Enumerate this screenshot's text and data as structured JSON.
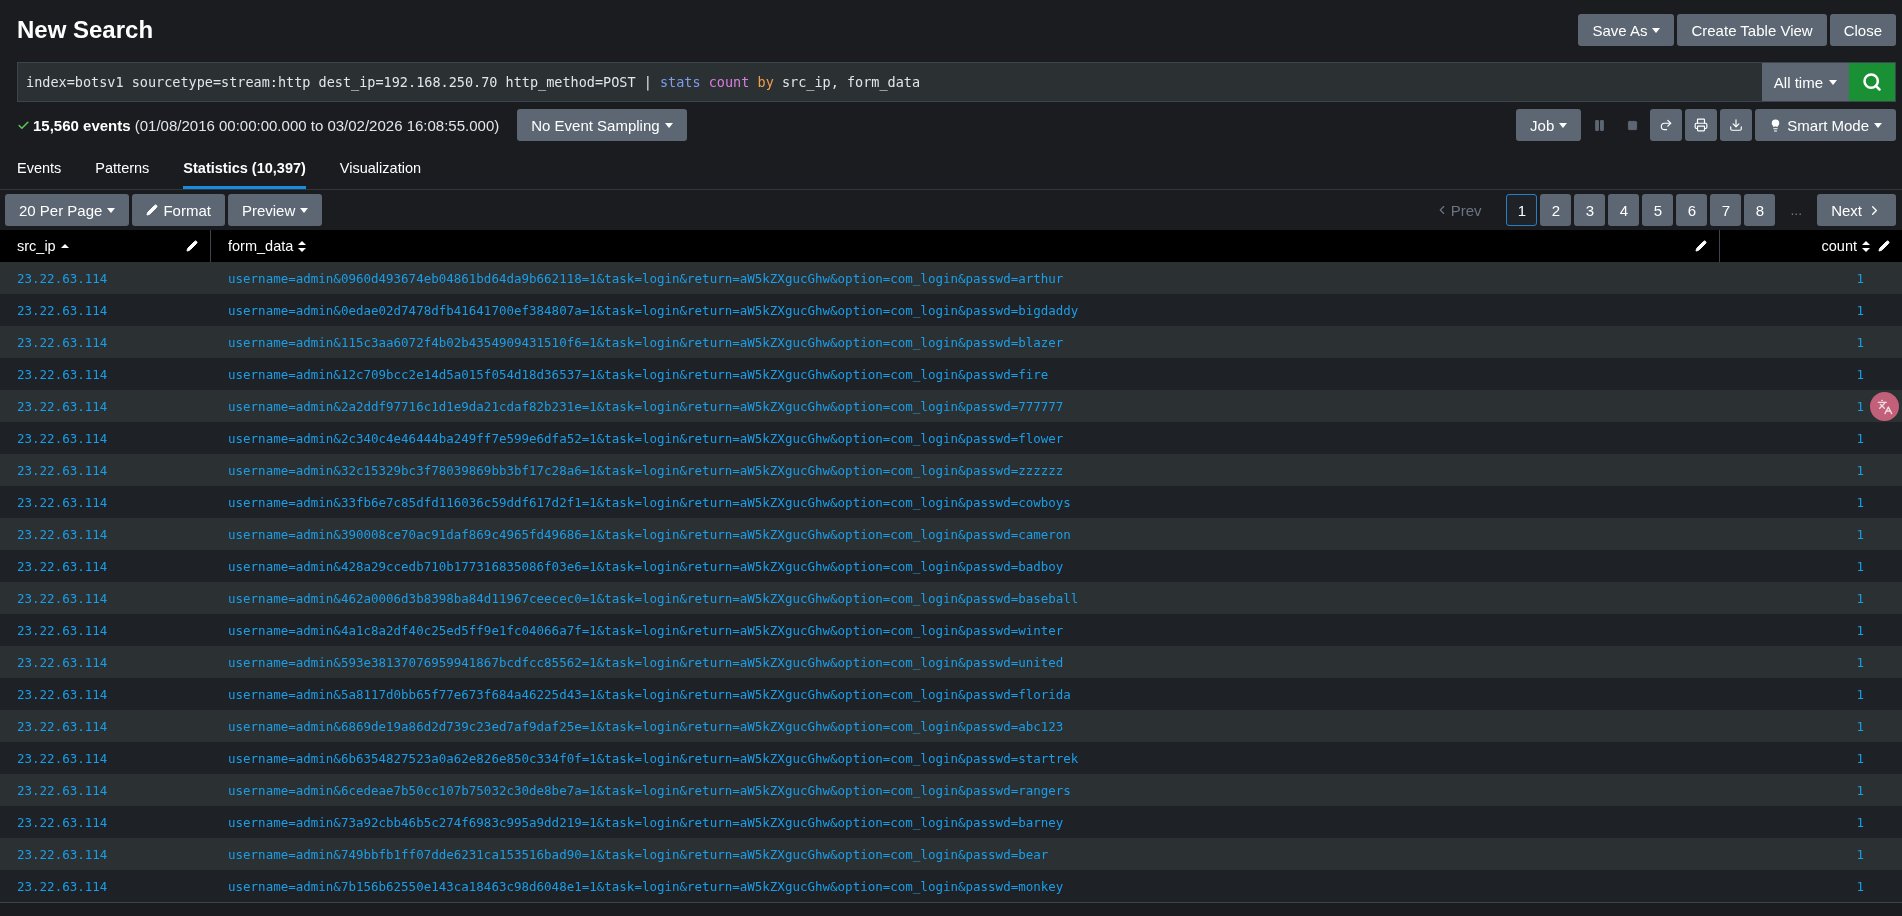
{
  "title": "New Search",
  "header_buttons": [
    {
      "label": "Save As",
      "dropdown": true
    },
    {
      "label": "Create Table View",
      "dropdown": false
    },
    {
      "label": "Close",
      "dropdown": false
    }
  ],
  "query": [
    {
      "kind": "plain",
      "text": "index=botsv1 sourcetype=stream:http dest_ip=192.168.250.70 http_method=POST | "
    },
    {
      "kind": "command",
      "text": "stats"
    },
    {
      "kind": "function",
      "text": " count"
    },
    {
      "kind": "keyword",
      "text": " by"
    },
    {
      "kind": "plain",
      "text": " src_ip, form_data"
    }
  ],
  "time_range": "All time",
  "status": {
    "count": "15,560 events",
    "range": "(01/08/2016 00:00:00.000 to 03/02/2026 16:08:55.000)",
    "sampling": "No Event Sampling"
  },
  "job": {
    "label": "Job",
    "mode": "Smart Mode"
  },
  "tabs": [
    {
      "label": "Events",
      "selected": false
    },
    {
      "label": "Patterns",
      "selected": false
    },
    {
      "label": "Statistics (10,397)",
      "selected": true
    },
    {
      "label": "Visualization",
      "selected": false
    }
  ],
  "toolbar": {
    "per_page": "20 Per Page",
    "format": "Format",
    "preview": "Preview"
  },
  "pagination": {
    "prev": "Prev",
    "next": "Next",
    "ellipsis": "...",
    "pages": [
      {
        "label": "1",
        "selected": true
      },
      {
        "label": "2",
        "selected": false
      },
      {
        "label": "3",
        "selected": false
      },
      {
        "label": "4",
        "selected": false
      },
      {
        "label": "5",
        "selected": false
      },
      {
        "label": "6",
        "selected": false
      },
      {
        "label": "7",
        "selected": false
      },
      {
        "label": "8",
        "selected": false
      }
    ]
  },
  "table": {
    "columns": [
      {
        "label": "src_ip",
        "sorted": true
      },
      {
        "label": "form_data",
        "sorted": false
      },
      {
        "label": "count",
        "sorted": false
      }
    ],
    "rows": [
      [
        "23.22.63.114",
        "username=admin&0960d493674eb04861bd64da9b662118=1&task=login&return=aW5kZXgucGhw&option=com_login&passwd=arthur",
        "1"
      ],
      [
        "23.22.63.114",
        "username=admin&0edae02d7478dfb41641700ef384807a=1&task=login&return=aW5kZXgucGhw&option=com_login&passwd=bigdaddy",
        "1"
      ],
      [
        "23.22.63.114",
        "username=admin&115c3aa6072f4b02b4354909431510f6=1&task=login&return=aW5kZXgucGhw&option=com_login&passwd=blazer",
        "1"
      ],
      [
        "23.22.63.114",
        "username=admin&12c709bcc2e14d5a015f054d18d36537=1&task=login&return=aW5kZXgucGhw&option=com_login&passwd=fire",
        "1"
      ],
      [
        "23.22.63.114",
        "username=admin&2a2ddf97716c1d1e9da21cdaf82b231e=1&task=login&return=aW5kZXgucGhw&option=com_login&passwd=777777",
        "1"
      ],
      [
        "23.22.63.114",
        "username=admin&2c340c4e46444ba249ff7e599e6dfa52=1&task=login&return=aW5kZXgucGhw&option=com_login&passwd=flower",
        "1"
      ],
      [
        "23.22.63.114",
        "username=admin&32c15329bc3f78039869bb3bf17c28a6=1&task=login&return=aW5kZXgucGhw&option=com_login&passwd=zzzzzz",
        "1"
      ],
      [
        "23.22.63.114",
        "username=admin&33fb6e7c85dfd116036c59ddf617d2f1=1&task=login&return=aW5kZXgucGhw&option=com_login&passwd=cowboys",
        "1"
      ],
      [
        "23.22.63.114",
        "username=admin&390008ce70ac91daf869c4965fd49686=1&task=login&return=aW5kZXgucGhw&option=com_login&passwd=cameron",
        "1"
      ],
      [
        "23.22.63.114",
        "username=admin&428a29ccedb710b177316835086f03e6=1&task=login&return=aW5kZXgucGhw&option=com_login&passwd=badboy",
        "1"
      ],
      [
        "23.22.63.114",
        "username=admin&462a0006d3b8398ba84d11967ceecec0=1&task=login&return=aW5kZXgucGhw&option=com_login&passwd=baseball",
        "1"
      ],
      [
        "23.22.63.114",
        "username=admin&4a1c8a2df40c25ed5ff9e1fc04066a7f=1&task=login&return=aW5kZXgucGhw&option=com_login&passwd=winter",
        "1"
      ],
      [
        "23.22.63.114",
        "username=admin&593e38137076959941867bcdfcc85562=1&task=login&return=aW5kZXgucGhw&option=com_login&passwd=united",
        "1"
      ],
      [
        "23.22.63.114",
        "username=admin&5a8117d0bb65f77e673f684a46225d43=1&task=login&return=aW5kZXgucGhw&option=com_login&passwd=florida",
        "1"
      ],
      [
        "23.22.63.114",
        "username=admin&6869de19a86d2d739c23ed7af9daf25e=1&task=login&return=aW5kZXgucGhw&option=com_login&passwd=abc123",
        "1"
      ],
      [
        "23.22.63.114",
        "username=admin&6b6354827523a0a62e826e850c334f0f=1&task=login&return=aW5kZXgucGhw&option=com_login&passwd=startrek",
        "1"
      ],
      [
        "23.22.63.114",
        "username=admin&6cedeae7b50cc107b75032c30de8be7a=1&task=login&return=aW5kZXgucGhw&option=com_login&passwd=rangers",
        "1"
      ],
      [
        "23.22.63.114",
        "username=admin&73a92cbb46b5c274f6983c995a9dd219=1&task=login&return=aW5kZXgucGhw&option=com_login&passwd=barney",
        "1"
      ],
      [
        "23.22.63.114",
        "username=admin&749bbfb1ff07dde6231ca153516bad90=1&task=login&return=aW5kZXgucGhw&option=com_login&passwd=bear",
        "1"
      ],
      [
        "23.22.63.114",
        "username=admin&7b156b62550e143ca18463c98d6048e1=1&task=login&return=aW5kZXgucGhw&option=com_login&passwd=monkey",
        "1"
      ]
    ]
  }
}
